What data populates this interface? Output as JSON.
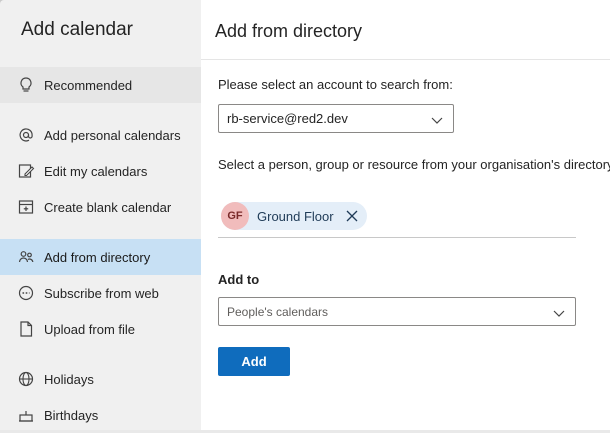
{
  "sidebar": {
    "title": "Add calendar",
    "items": [
      {
        "label": "Recommended",
        "icon": "lightbulb-icon"
      },
      {
        "label": "Add personal calendars",
        "icon": "at-icon"
      },
      {
        "label": "Edit my calendars",
        "icon": "edit-icon"
      },
      {
        "label": "Create blank calendar",
        "icon": "calendar-icon"
      },
      {
        "label": "Add from directory",
        "icon": "people-icon",
        "active": true
      },
      {
        "label": "Subscribe from web",
        "icon": "link-icon"
      },
      {
        "label": "Upload from file",
        "icon": "file-upload-icon"
      },
      {
        "label": "Holidays",
        "icon": "globe-icon"
      },
      {
        "label": "Birthdays",
        "icon": "cake-icon"
      }
    ]
  },
  "main": {
    "title": "Add from directory",
    "account_prompt": "Please select an account to search from:",
    "account_select": {
      "value": "rb-service@red2.dev"
    },
    "person_prompt": "Select a person, group or resource from your organisation's directory to",
    "chip": {
      "initials": "GF",
      "name": "Ground Floor"
    },
    "add_to_label": "Add to",
    "calendar_select": {
      "value": "People's calendars"
    },
    "add_button": "Add"
  },
  "colors": {
    "accent": "#0f6cbd",
    "active_nav": "#c7e0f4",
    "chip_bg": "#e4eef8",
    "avatar_bg": "#f1bcbc"
  }
}
